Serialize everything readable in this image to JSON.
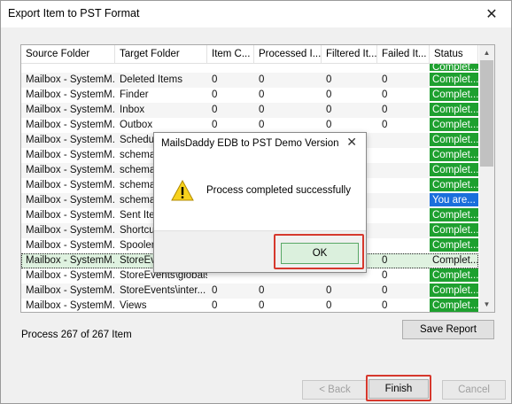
{
  "window": {
    "title": "Export Item to PST Format",
    "close_glyph": "✕"
  },
  "grid": {
    "columns": [
      "Source Folder",
      "Target Folder",
      "Item C...",
      "Processed I...",
      "Filtered It...",
      "Failed It...",
      "Status"
    ],
    "rows": [
      {
        "source": "",
        "target": "",
        "items": "",
        "processed": "",
        "filtered": "",
        "failed": "",
        "status": "Complet...",
        "status_color": "green"
      },
      {
        "source": "Mailbox - SystemM...",
        "target": "Deleted Items",
        "items": "0",
        "processed": "0",
        "filtered": "0",
        "failed": "0",
        "status": "Complet...",
        "status_color": "green"
      },
      {
        "source": "Mailbox - SystemM...",
        "target": "Finder",
        "items": "0",
        "processed": "0",
        "filtered": "0",
        "failed": "0",
        "status": "Complet...",
        "status_color": "green"
      },
      {
        "source": "Mailbox - SystemM...",
        "target": "Inbox",
        "items": "0",
        "processed": "0",
        "filtered": "0",
        "failed": "0",
        "status": "Complet...",
        "status_color": "green"
      },
      {
        "source": "Mailbox - SystemM...",
        "target": "Outbox",
        "items": "0",
        "processed": "0",
        "filtered": "0",
        "failed": "0",
        "status": "Complet...",
        "status_color": "green"
      },
      {
        "source": "Mailbox - SystemM...",
        "target": "Schedul",
        "items": "",
        "processed": "",
        "filtered": "",
        "failed": "",
        "status": "Complet...",
        "status_color": "green"
      },
      {
        "source": "Mailbox - SystemM...",
        "target": "schema",
        "items": "",
        "processed": "",
        "filtered": "",
        "failed": "",
        "status": "Complet...",
        "status_color": "green"
      },
      {
        "source": "Mailbox - SystemM...",
        "target": "schema",
        "items": "",
        "processed": "",
        "filtered": "",
        "failed": "",
        "status": "Complet...",
        "status_color": "green"
      },
      {
        "source": "Mailbox - SystemM...",
        "target": "schema",
        "items": "",
        "processed": "",
        "filtered": "",
        "failed": "",
        "status": "Complet...",
        "status_color": "green"
      },
      {
        "source": "Mailbox - SystemM...",
        "target": "schema",
        "items": "",
        "processed": "",
        "filtered": "",
        "failed": "",
        "status": "You are...",
        "status_color": "blue"
      },
      {
        "source": "Mailbox - SystemM...",
        "target": "Sent Iter",
        "items": "",
        "processed": "",
        "filtered": "",
        "failed": "",
        "status": "Complet...",
        "status_color": "green"
      },
      {
        "source": "Mailbox - SystemM...",
        "target": "Shortcut",
        "items": "",
        "processed": "",
        "filtered": "",
        "failed": "",
        "status": "Complet...",
        "status_color": "green"
      },
      {
        "source": "Mailbox - SystemM...",
        "target": "Spooler",
        "items": "",
        "processed": "",
        "filtered": "",
        "failed": "",
        "status": "Complet...",
        "status_color": "green"
      },
      {
        "source": "Mailbox - SystemM...",
        "target": "StoreEve",
        "items": "",
        "processed": "",
        "filtered": "",
        "failed": "0",
        "status": "Complet...",
        "status_color": "selected"
      },
      {
        "source": "Mailbox - SystemM...",
        "target": "StoreEvents\\globals",
        "items": "",
        "processed": "",
        "filtered": "",
        "failed": "0",
        "status": "Complet...",
        "status_color": "green"
      },
      {
        "source": "Mailbox - SystemM...",
        "target": "StoreEvents\\inter...",
        "items": "0",
        "processed": "0",
        "filtered": "0",
        "failed": "0",
        "status": "Complet...",
        "status_color": "green"
      },
      {
        "source": "Mailbox - SystemM...",
        "target": "Views",
        "items": "0",
        "processed": "0",
        "filtered": "0",
        "failed": "0",
        "status": "Complet...",
        "status_color": "green"
      }
    ]
  },
  "progress_text": "Process 267 of 267 Item",
  "buttons": {
    "save_report": "Save Report",
    "back": "< Back",
    "finish": "Finish",
    "cancel": "Cancel"
  },
  "dialog": {
    "title": "MailsDaddy EDB to PST Demo Version",
    "message": "Process completed successfully",
    "ok": "OK",
    "icon": "warning-icon"
  },
  "colors": {
    "status_green": "#1ea02f",
    "status_blue": "#1b6fdc",
    "highlight_red": "#d6382d"
  }
}
